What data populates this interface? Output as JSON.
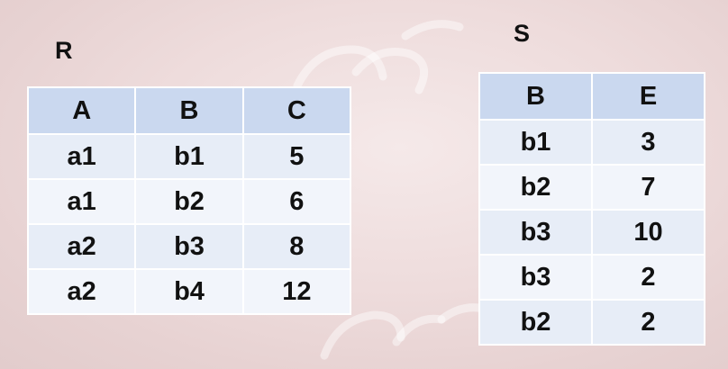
{
  "relation_r": {
    "name": "R",
    "headers": [
      "A",
      "B",
      "C"
    ],
    "rows": [
      [
        "a1",
        "b1",
        "5"
      ],
      [
        "a1",
        "b2",
        "6"
      ],
      [
        "a2",
        "b3",
        "8"
      ],
      [
        "a2",
        "b4",
        "12"
      ]
    ]
  },
  "relation_s": {
    "name": "S",
    "headers": [
      "B",
      "E"
    ],
    "rows": [
      [
        "b1",
        "3"
      ],
      [
        "b2",
        "7"
      ],
      [
        "b3",
        "10"
      ],
      [
        "b3",
        "2"
      ],
      [
        "b2",
        "2"
      ]
    ]
  }
}
